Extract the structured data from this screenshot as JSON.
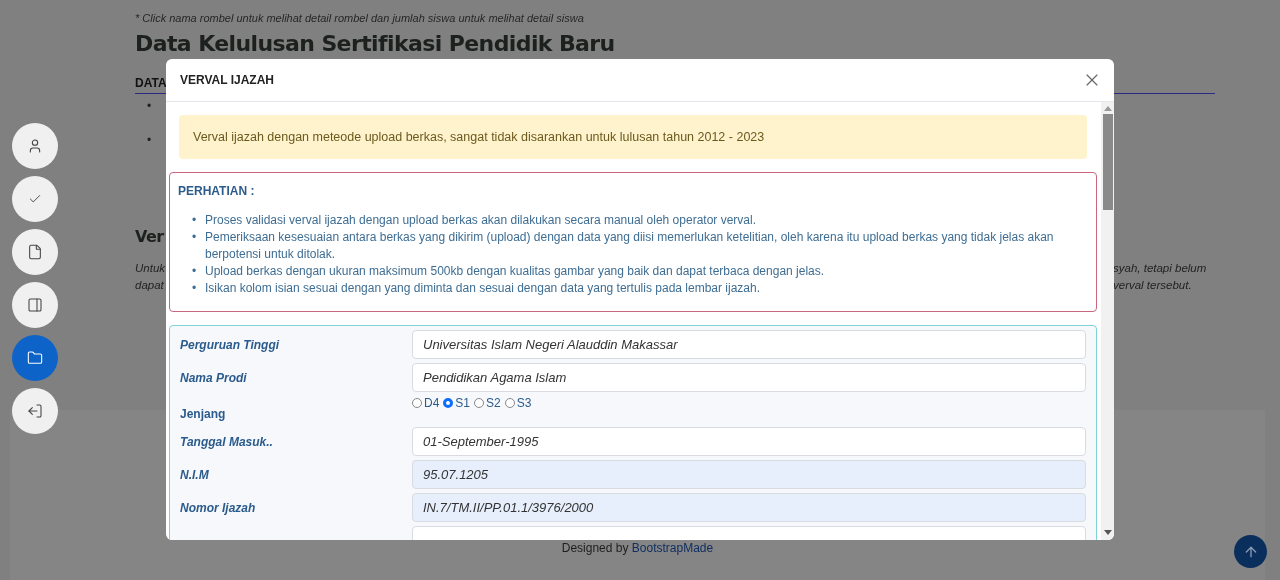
{
  "page": {
    "note": "* Click nama rombel untuk melihat detail rombel dan jumlah siswa untuk melihat detail siswa",
    "heading": "Data Kelulusan Sertifikasi Pendidik Baru",
    "section_label": "DATA",
    "bullets": [
      "•",
      "•"
    ],
    "heading_2": "Ver",
    "paragraph_left": [
      "Untuk",
      "dapat"
    ],
    "paragraph_right": [
      "syah, tetapi belum",
      "verval tersebut."
    ],
    "footer": {
      "prefix": "Designed by",
      "link": "BootstrapMade"
    }
  },
  "sidebar": {
    "items": [
      {
        "selected": false
      },
      {
        "selected": false
      },
      {
        "selected": false
      },
      {
        "selected": false
      },
      {
        "selected": true
      },
      {
        "selected": false
      }
    ]
  },
  "modal": {
    "title": "VERVAL IJAZAH",
    "warning": "Verval ijazah dengan meteode upload berkas, sangat tidak disarankan untuk lulusan tahun 2012 - 2023",
    "notice": {
      "title": "PERHATIAN :",
      "items": [
        {
          "marker": "•",
          "text": "Proses validasi verval ijazah dengan upload berkas akan dilakukan secara manual oleh operator verval."
        },
        {
          "marker": "•",
          "text": "Pemeriksaan kesesuaian antara berkas yang dikirim (upload) dengan data yang diisi memerlukan ketelitian, oleh karena itu upload berkas yang tidak jelas akan berpotensi untuk ditolak."
        },
        {
          "marker": "•",
          "text": "Upload berkas dengan ukuran maksimum 500kb dengan kualitas gambar yang baik dan dapat terbaca dengan jelas."
        },
        {
          "marker": "•",
          "text": "Isikan kolom isian sesuai dengan yang diminta dan sesuai dengan data yang tertulis pada lembar ijazah."
        }
      ]
    },
    "fields": [
      {
        "kind": "text",
        "label": "Perguruan Tinggi",
        "value": "Universitas Islam Negeri Alauddin Makassar",
        "readonly": false
      },
      {
        "kind": "text",
        "label": "Nama Prodi",
        "value": "Pendidikan Agama Islam",
        "readonly": false
      },
      {
        "kind": "radio",
        "label": "Jenjang",
        "options": [
          {
            "label": "D4",
            "selected": false
          },
          {
            "label": "S1",
            "selected": true
          },
          {
            "label": "S2",
            "selected": false
          },
          {
            "label": "S3",
            "selected": false
          }
        ]
      },
      {
        "kind": "text",
        "label": "Tanggal Masuk..",
        "value": "01-September-1995",
        "readonly": false
      },
      {
        "kind": "text",
        "label": "N.I.M",
        "value": "95.07.1205",
        "readonly": true
      },
      {
        "kind": "text",
        "label": "Nomor Ijazah",
        "value": "IN.7/TM.II/PP.01.1/3976/2000",
        "readonly": true
      },
      {
        "kind": "text",
        "readonly": false
      }
    ]
  }
}
